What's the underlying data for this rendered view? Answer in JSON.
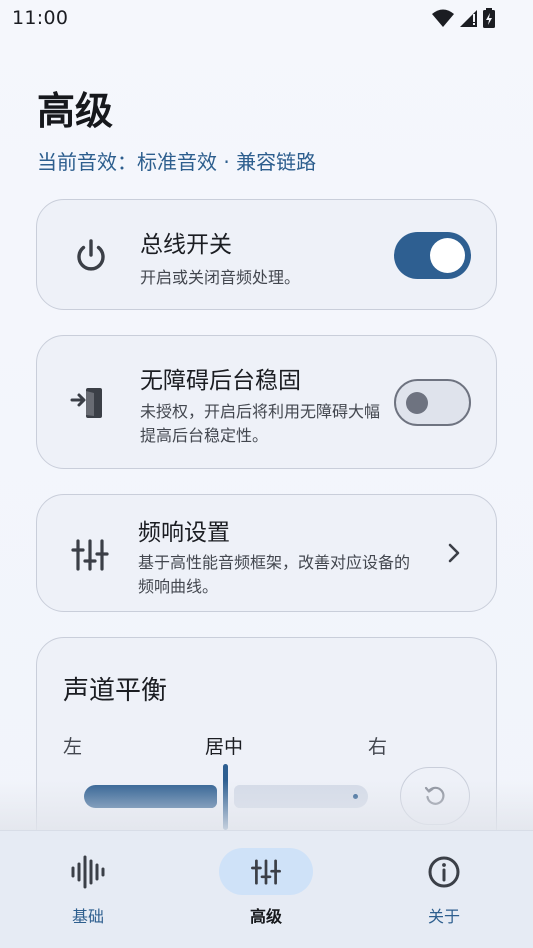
{
  "status_bar": {
    "time": "11:00"
  },
  "header": {
    "title": "高级",
    "subtitle": "当前音效：标准音效 · 兼容链路"
  },
  "bus_switch": {
    "title": "总线开关",
    "description": "开启或关闭音频处理。",
    "icon": "power-icon",
    "enabled": true
  },
  "background_keepalive": {
    "title": "无障碍后台稳固",
    "description": "未授权，开启后将利用无障碍大幅提高后台稳定性。",
    "icon": "login-icon",
    "enabled": false
  },
  "frequency_settings": {
    "title": "频响设置",
    "description": "基于高性能音频框架，改善对应设备的频响曲线。",
    "icon": "tune-icon"
  },
  "channel_balance": {
    "title": "声道平衡",
    "label_left": "左",
    "label_center": "居中",
    "label_right": "右",
    "balance_position": 0.5,
    "reset_icon": "reset-icon"
  },
  "bottom_nav": {
    "items": [
      {
        "label": "基础",
        "icon": "waveform-icon",
        "selected": false
      },
      {
        "label": "高级",
        "icon": "tune-icon",
        "selected": true
      },
      {
        "label": "关于",
        "icon": "info-icon",
        "selected": false
      }
    ]
  },
  "colors": {
    "accent": "#2e5f91",
    "subtitle": "#2d5e8e",
    "card_bg": "#eef1f8",
    "nav_selected_bg": "#cfe2f8"
  }
}
